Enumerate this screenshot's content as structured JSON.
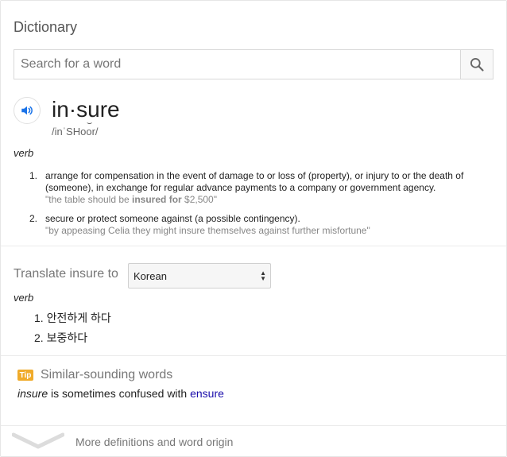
{
  "header": {
    "title": "Dictionary"
  },
  "search": {
    "placeholder": "Search for a word",
    "icon": "search-icon"
  },
  "entry": {
    "word": "in·sure",
    "phonetic": "/inˈSHo͝or/",
    "phonetic_display": "/inˈSHoor/",
    "part_of_speech": "verb",
    "definitions": [
      {
        "num": "1.",
        "text": "arrange for compensation in the event of damage to or loss of (property), or injury to or the death of (someone), in exchange for regular advance payments to a company or government agency.",
        "example_prefix": "\"the table should be ",
        "example_bold": "insured for",
        "example_suffix": " $2,500\""
      },
      {
        "num": "2.",
        "text": "secure or protect someone against (a possible contingency).",
        "example": "\"by appeasing Celia they might insure themselves against further misfortune\""
      }
    ]
  },
  "translate": {
    "label": "Translate insure to",
    "selected_language": "Korean",
    "part_of_speech": "verb",
    "items": [
      {
        "num": "1.",
        "text": "안전하게 하다"
      },
      {
        "num": "2.",
        "text": "보중하다"
      }
    ]
  },
  "tip": {
    "badge": "Tip",
    "heading": "Similar-sounding words",
    "word": "insure",
    "middle": " is sometimes confused with ",
    "link": "ensure"
  },
  "footer": {
    "more_label": "More definitions and word origin"
  },
  "colors": {
    "tip_badge": "#f0ab2a",
    "link": "#1a0dab",
    "speaker_blue": "#1a73e8"
  }
}
